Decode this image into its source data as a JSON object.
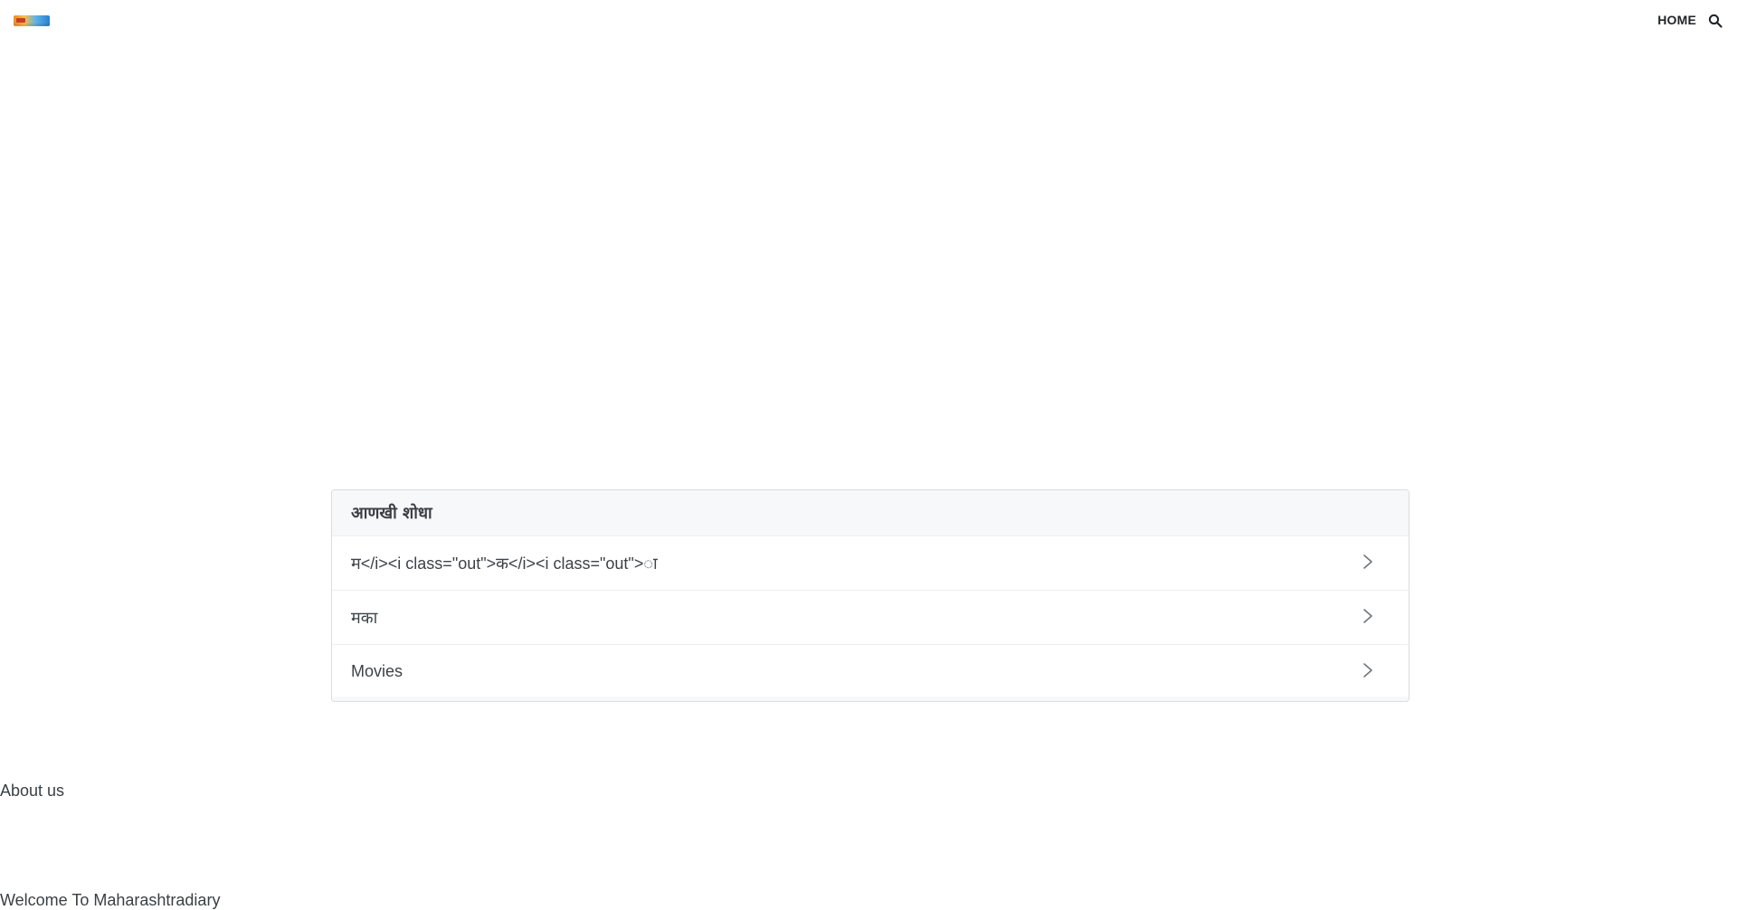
{
  "header": {
    "logo_icon": "site-logo",
    "home_label": "HOME",
    "search_icon": "search-icon"
  },
  "search_card": {
    "title": "आणखी शोधा",
    "items": [
      {
        "label": "म</i><i class=\"out\">क</i><i class=\"out\">ा"
      },
      {
        "label": "मका"
      },
      {
        "label": "Movies"
      }
    ],
    "item_icon": "chevron-right-icon"
  },
  "footer": {
    "about_label": "About us",
    "welcome_text": "Welcome To Maharashtradiary"
  },
  "colors": {
    "border": "#d9dce0",
    "header_bg": "#f7f8f9",
    "text": "#3d4247"
  }
}
